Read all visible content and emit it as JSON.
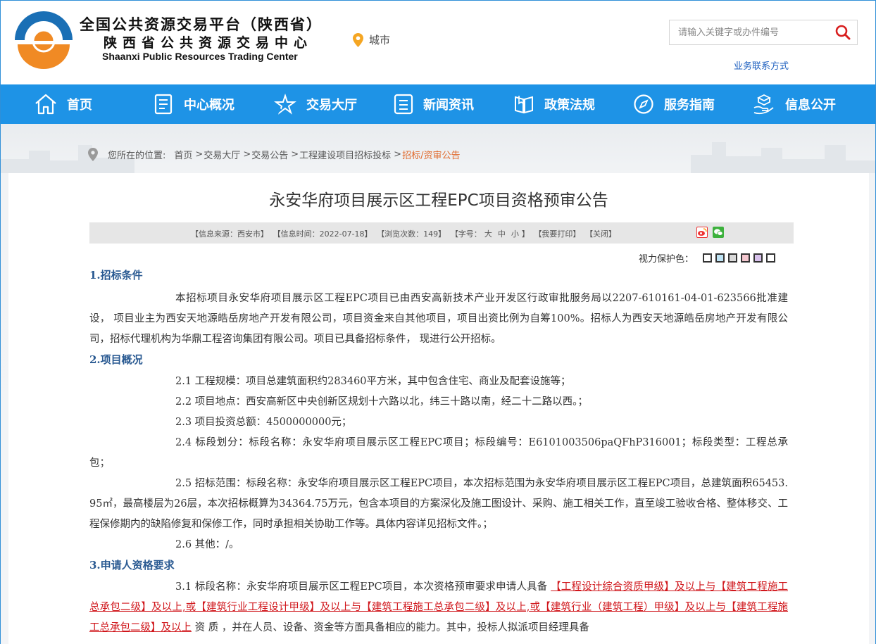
{
  "header": {
    "logo_line1": "全国公共资源交易平台（陕西省）",
    "logo_line2": "陕西省公共资源交易中心",
    "logo_line3": "Shaanxi Public Resources Trading Center",
    "city": "城市",
    "search_placeholder": "请输入关键字或办件编号",
    "contact": "业务联系方式"
  },
  "nav": {
    "items": [
      {
        "label": "首页",
        "icon": "home-icon"
      },
      {
        "label": "中心概况",
        "icon": "document-icon"
      },
      {
        "label": "交易大厅",
        "icon": "star-icon"
      },
      {
        "label": "新闻资讯",
        "icon": "news-icon"
      },
      {
        "label": "政策法规",
        "icon": "book-icon"
      },
      {
        "label": "服务指南",
        "icon": "compass-icon"
      },
      {
        "label": "信息公开",
        "icon": "hand-icon"
      }
    ]
  },
  "breadcrumb": {
    "prefix": "您所在的位置:",
    "items": [
      "首页",
      "交易大厅",
      "交易公告",
      "工程建设项目招标投标"
    ],
    "separator": ">",
    "current": "招标/资审公告"
  },
  "article": {
    "title": "永安华府项目展示区工程EPC项目资格预审公告",
    "info": {
      "source": "【信息来源：西安市】",
      "time": "【信息时间：2022-07-18】",
      "views": "【浏览次数：149】",
      "font_label": "【字号：",
      "font_large": "大",
      "font_medium": "中",
      "font_small": "小",
      "font_end": "】",
      "print": "【我要打印】",
      "close": "【关闭】"
    },
    "eyecare_label": "视力保护色：",
    "swatches": [
      "#ffffff",
      "#bfe4f5",
      "#d9d9d9",
      "#f4c7cf",
      "#d8c1ec",
      "#ffffff"
    ],
    "s1_heading": "1.招标条件",
    "s1_p1": "本招标项目永安华府项目展示区工程EPC项目已由西安高新技术产业开发区行政审批服务局以2207-610161-04-01-623566批准建设， 项目业主为西安天地源皓岳房地产开发有限公司，项目资金来自其他项目，项目出资比例为自筹100%。招标人为西安天地源皓岳房地产开发有限公司，招标代理机构为华鼎工程咨询集团有限公司。项目已具备招标条件， 现进行公开招标。",
    "s2_heading": "2.项目概况",
    "s2_items": [
      "2.1 工程规模：项目总建筑面积约283460平方米，其中包含住宅、商业及配套设施等；",
      "2.2 项目地点：西安高新区中央创新区规划十六路以北，纬三十路以南，经二十二路以西。；",
      "2.3 项目投资总额：4500000000元；",
      "2.4 标段划分：标段名称：永安华府项目展示区工程EPC项目；标段编号：E6101003506paQFhP316001；标段类型：工程总承包；",
      "2.5 招标范围：标段名称：永安华府项目展示区工程EPC项目，本次招标范围为永安华府项目展示区工程EPC项目，总建筑面积65453.95㎡，最高楼层为26层，本次招标概算为34364.75万元，包含本项目的方案深化及施工图设计、采购、施工相关工作，直至竣工验收合格、整体移交、工程保修期内的缺陷修复和保修工作，同时承担相关协助工作等。具体内容详见招标文件。；",
      "2.6 其他：/。"
    ],
    "s3_heading": "3.申请人资格要求",
    "s3_p1_start": "3.1 标段名称：永安华府项目展示区工程EPC项目，本次资格预审要求申请人具备 ",
    "s3_p1_red": "【工程设计综合资质甲级】及以上与【建筑工程施工总承包二级】及以上,或【建筑行业工程设计甲级】及以上与【建筑工程施工总承包二级】及以上,或【建筑行业（建筑工程）甲级】及以上与【建筑工程施工总承包二级】及以上",
    "s3_p1_end": " 资 质 ，并在人员、设备、资金等方面具备相应的能力。其中，投标人拟派项目经理具备"
  },
  "colors": {
    "nav_bg": "#1e93e6",
    "heading": "#2a5a92",
    "highlight": "#d0161b",
    "breadcrumb_current": "#e06a2c",
    "logo_blue": "#1a6fb5",
    "logo_orange": "#f08a24"
  }
}
